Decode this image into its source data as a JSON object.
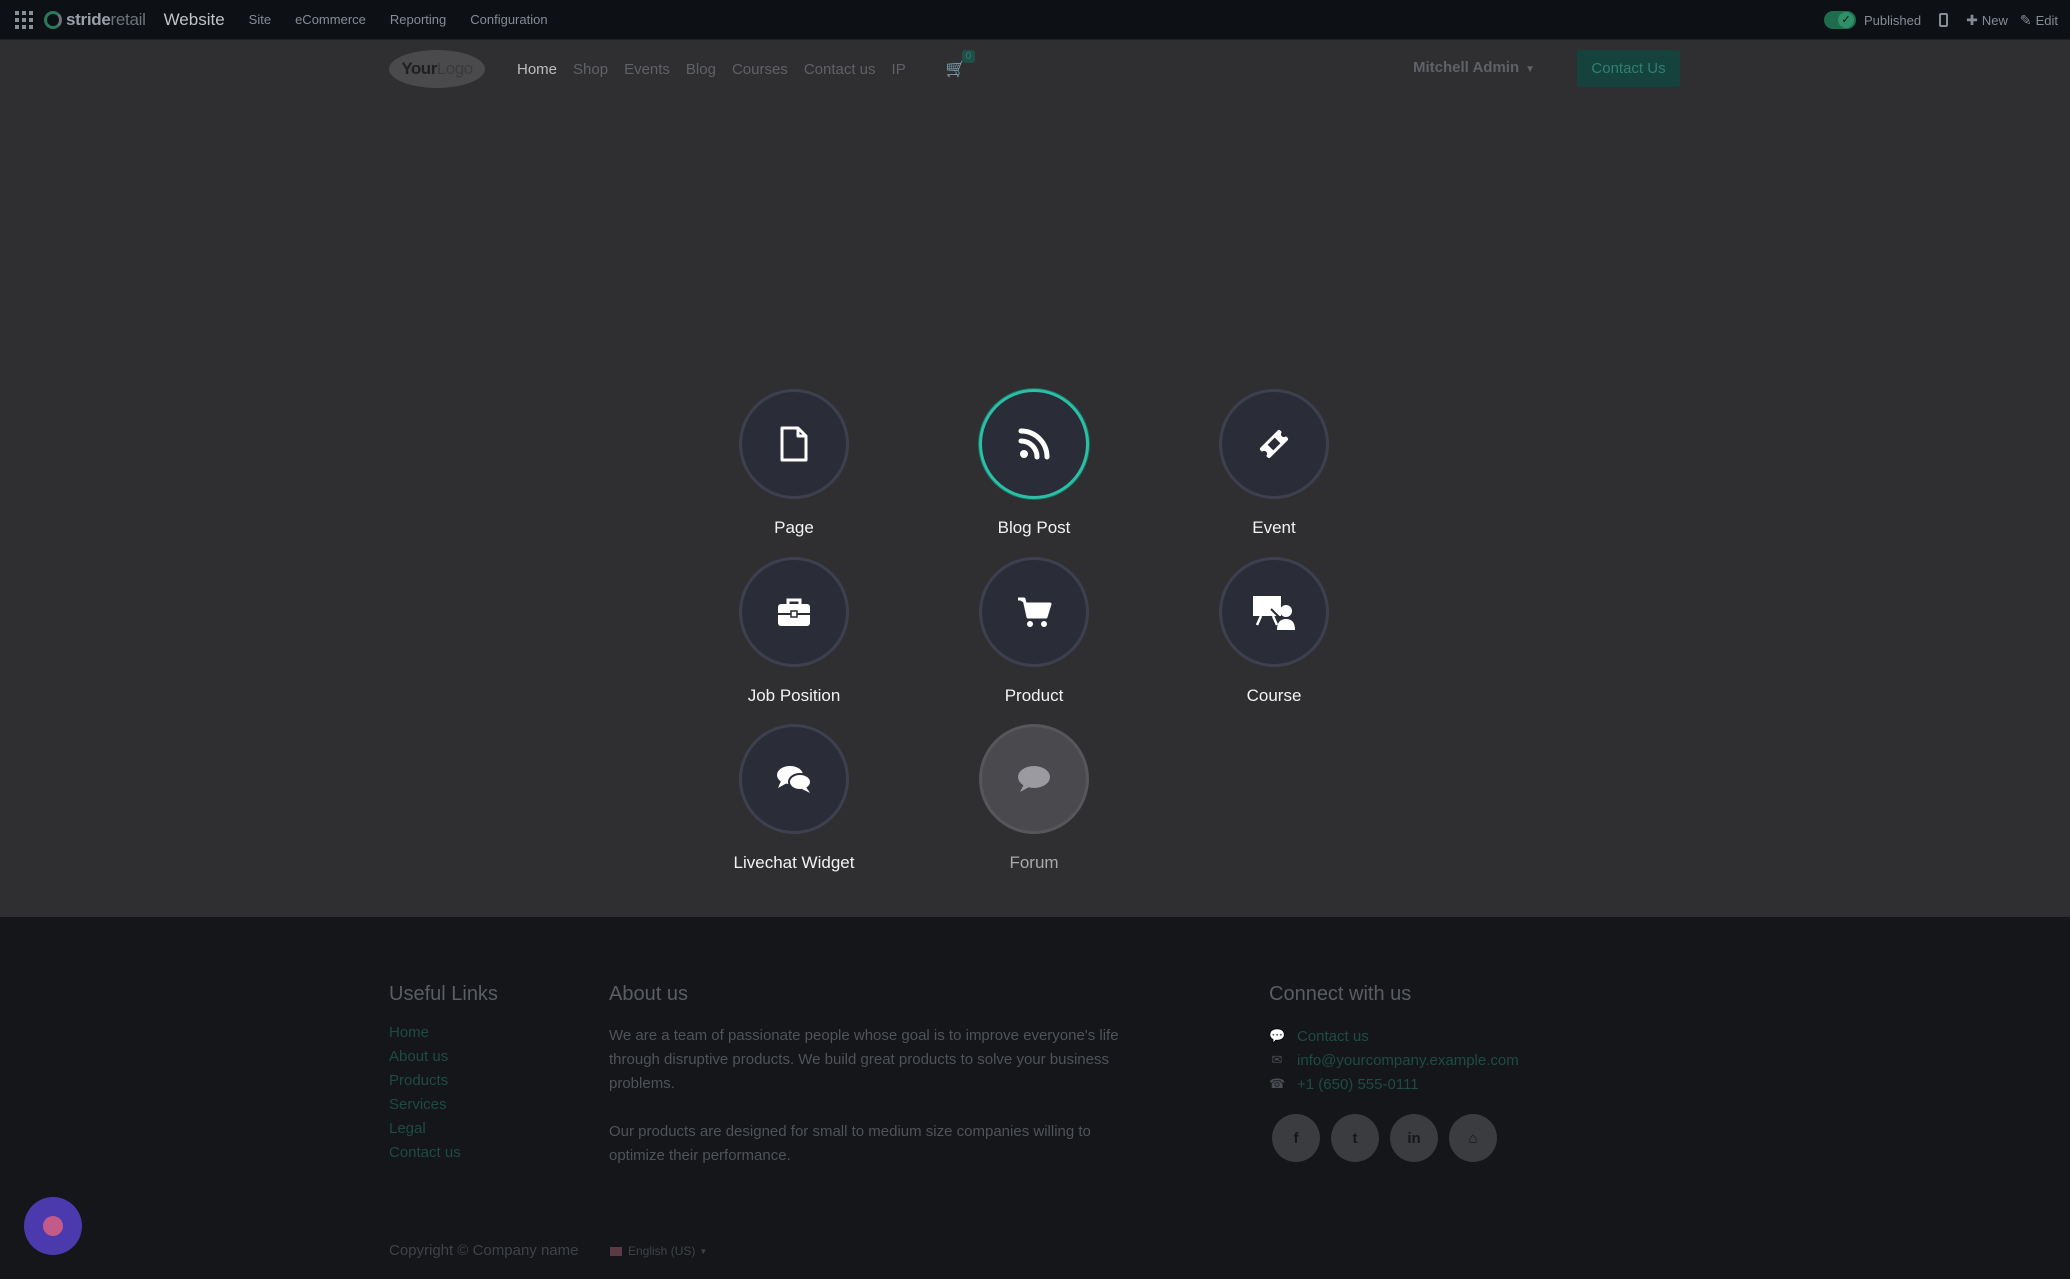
{
  "topbar": {
    "brand_strong": "stride",
    "brand_light": "retail",
    "module": "Website",
    "menu": [
      "Site",
      "eCommerce",
      "Reporting",
      "Configuration"
    ],
    "published_label": "Published",
    "new_label": "New",
    "edit_label": "Edit"
  },
  "header": {
    "logo_part1": "Your",
    "logo_part2": "Logo",
    "nav": [
      "Home",
      "Shop",
      "Events",
      "Blog",
      "Courses",
      "Contact us",
      "IP"
    ],
    "cart_count": "0",
    "user": "Mitchell Admin",
    "contact_button": "Contact Us"
  },
  "new_content": {
    "options": [
      {
        "label": "Page",
        "icon": "file-icon"
      },
      {
        "label": "Blog Post",
        "icon": "rss-icon"
      },
      {
        "label": "Event",
        "icon": "ticket-icon"
      },
      {
        "label": "Job Position",
        "icon": "briefcase-icon"
      },
      {
        "label": "Product",
        "icon": "cart-icon"
      },
      {
        "label": "Course",
        "icon": "presentation-icon"
      },
      {
        "label": "Livechat Widget",
        "icon": "comments-icon"
      },
      {
        "label": "Forum",
        "icon": "comment-icon"
      }
    ],
    "selected": "Blog Post",
    "disabled": "Forum"
  },
  "footer": {
    "useful_links_title": "Useful Links",
    "useful_links": [
      "Home",
      "About us",
      "Products",
      "Services",
      "Legal",
      "Contact us"
    ],
    "about_title": "About us",
    "about_p1": "We are a team of passionate people whose goal is to improve everyone's life through disruptive products. We build great products to solve your business problems.",
    "about_p2": "Our products are designed for small to medium size companies willing to optimize their performance.",
    "connect_title": "Connect with us",
    "contact_link": "Contact us",
    "email": "info@yourcompany.example.com",
    "phone": "+1 (650) 555-0111",
    "socials": [
      "f",
      "t",
      "in",
      "home"
    ],
    "copyright": "Copyright © Company name",
    "language": "English (US)"
  },
  "colors": {
    "accent": "#2bbfa6",
    "primary_button": "#16423d",
    "circle_bg": "#2a2c37"
  }
}
